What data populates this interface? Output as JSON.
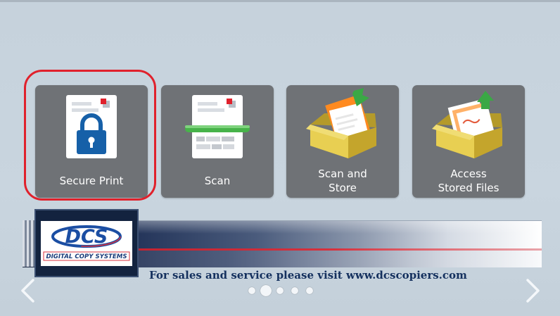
{
  "tiles": [
    {
      "id": "secure-print",
      "label": "Secure Print",
      "icon": "lock-document-icon"
    },
    {
      "id": "scan",
      "label": "Scan",
      "icon": "scan-document-icon"
    },
    {
      "id": "scan-and-store",
      "label_lines": [
        "Scan and",
        "Store"
      ],
      "icon": "box-store-icon"
    },
    {
      "id": "access-stored-files",
      "label_lines": [
        "Access",
        "Stored Files"
      ],
      "icon": "box-retrieve-icon"
    }
  ],
  "banner": {
    "logo_text": "DCS",
    "logo_subtext": "DIGITAL COPY SYSTEMS",
    "sales_text": "For sales and service please visit www.dcscopiers.com"
  },
  "pager": {
    "count": 5,
    "active": 1
  },
  "nav": {
    "prev_icon": "chevron-left-icon",
    "next_icon": "chevron-right-icon"
  },
  "colors": {
    "tile": "#6f7276",
    "highlight": "#e0212c",
    "lock_blue": "#1660a8",
    "scan_green": "#47b34a",
    "brand_navy": "#14305e",
    "brand_red": "#d8313d"
  }
}
